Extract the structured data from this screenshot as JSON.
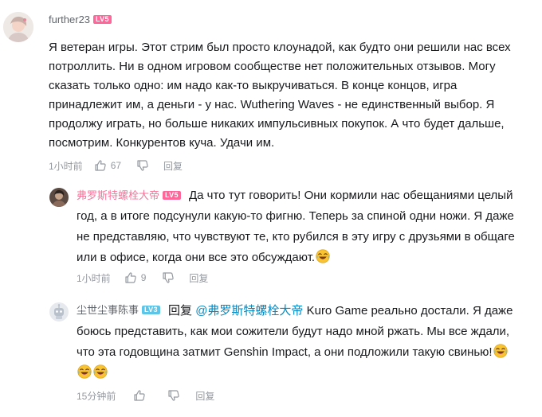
{
  "comments": [
    {
      "username": "further23",
      "level": "LV5",
      "level_color": "#ff6699",
      "username_color": "#61666d",
      "text": "Я ветеран игры. Этот стрим был просто клоунадой, как будто они решили нас всех потроллить. Ни в одном игровом сообществе нет положительных отзывов. Могу сказать только одно: им надо как-то выкручиваться. В конце концов, игра принадлежит им, а деньги - у нас. Wuthering Waves - не единственный выбор. Я продолжу играть, но больше никаких импульсивных покупок. А что будет дальше, посмотрим. Конкурентов куча. Удачи им.",
      "time": "1小时前",
      "likes": "67",
      "reply_label": "回复"
    }
  ],
  "replies": [
    {
      "username": "弗罗斯特螺栓大帝",
      "level": "LV5",
      "level_color": "#ff6699",
      "username_color": "#fb7299",
      "text": "Да что тут говорить! Они кормили нас обещаниями целый год, а в итоге подсунули какую-то фигню. Теперь за спиной одни ножи. Я даже не представляю, что чувствуют те, кто рубился в эту игру с друзьями в общаге или в офисе, когда они все это обсуждают.",
      "emoji": "laugh-cry-emoji",
      "time": "1小时前",
      "likes": "9",
      "reply_label": "回复"
    },
    {
      "username": "尘世尘事陈事",
      "level": "LV3",
      "level_color": "#5cc5e8",
      "username_color": "#61666d",
      "reply_prefix": "回复",
      "mention": "@弗罗斯特螺栓大帝",
      "text": "Kuro Game реально достали. Я даже боюсь представить, как мои сожители будут надо мной ржать. Мы все ждали, что эта годовщина затмит Genshin Impact, а они подложили такую свинью!",
      "emoji": "laugh-cry-emoji",
      "time": "15分钟前",
      "likes": "",
      "reply_label": "回复"
    }
  ],
  "colors": {
    "meta": "#9499a0",
    "mention": "#008ac5",
    "text": "#18191c"
  }
}
